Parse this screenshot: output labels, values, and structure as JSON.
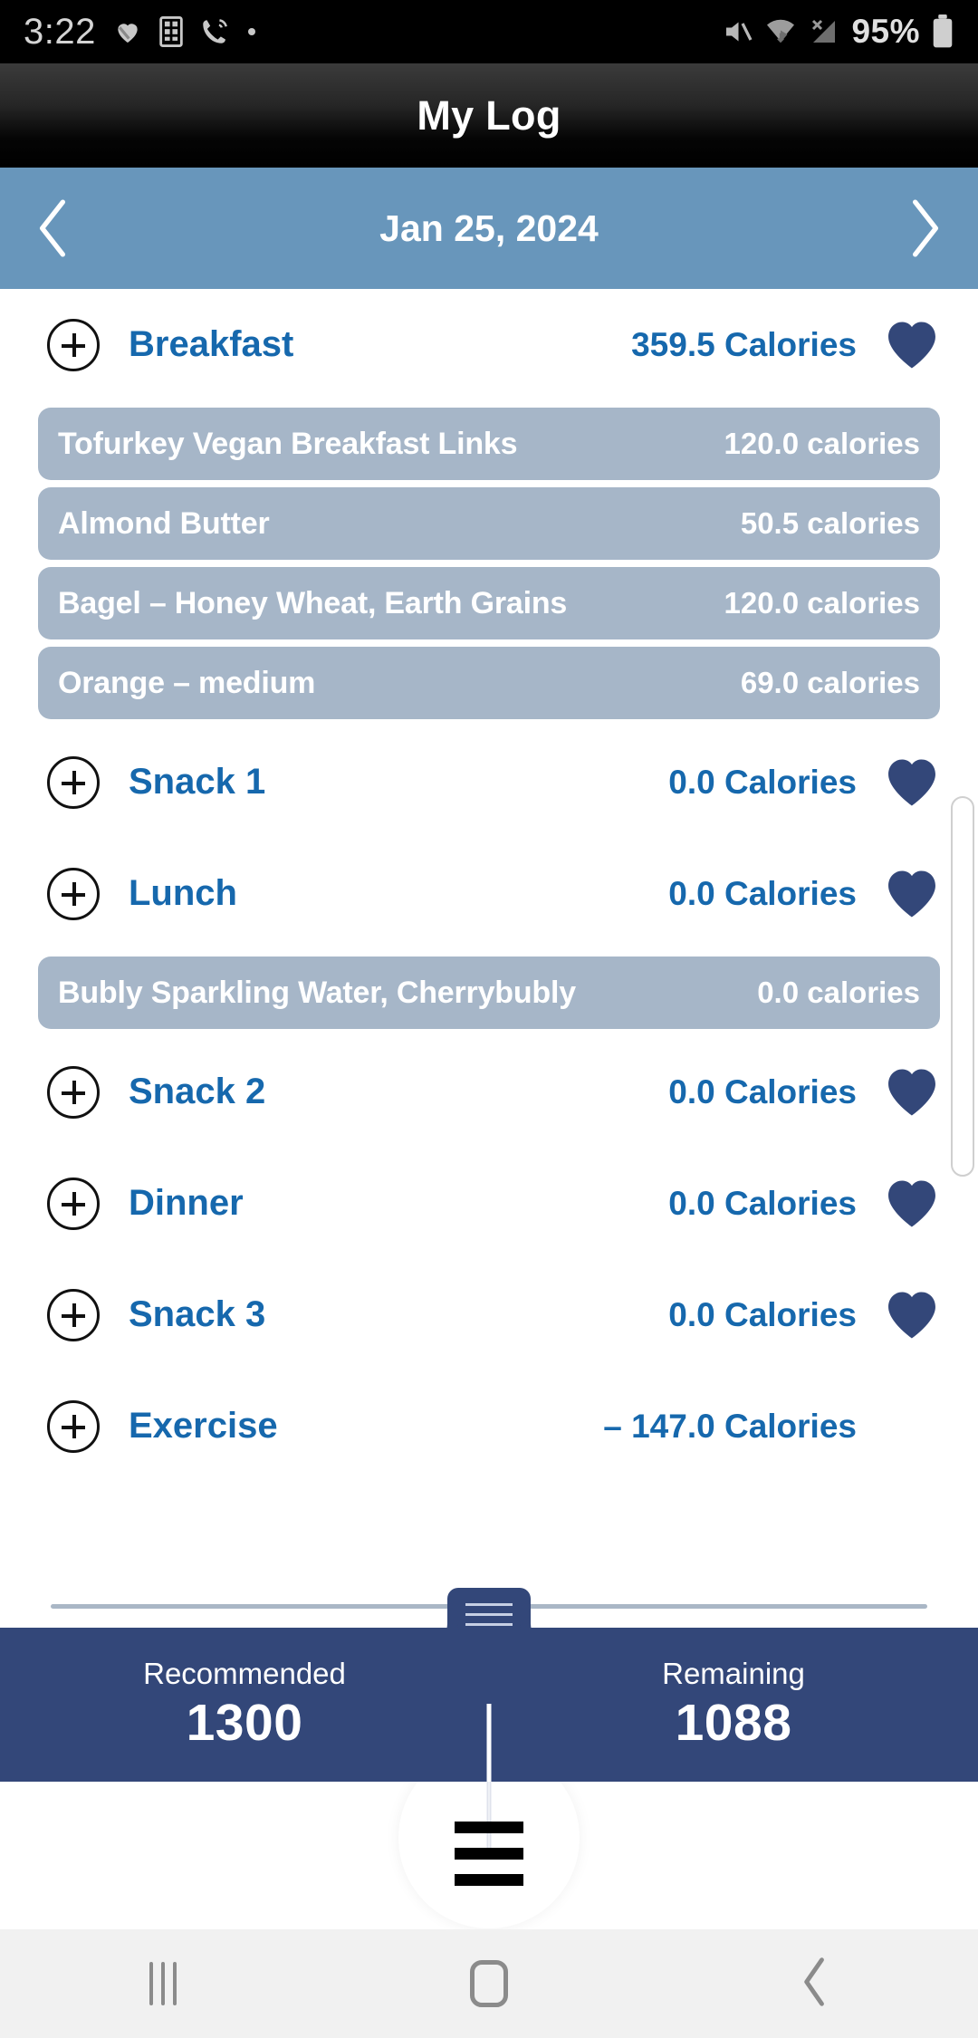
{
  "status_bar": {
    "time": "3:22",
    "battery_percent": "95%",
    "left_icons": [
      "heart-icon",
      "app-grid-icon",
      "wifi-calling-icon",
      "dot-icon"
    ],
    "right_icons": [
      "mute-icon",
      "wifi-icon",
      "signal-off-icon",
      "battery-icon"
    ]
  },
  "header": {
    "title": "My Log"
  },
  "date_bar": {
    "date": "Jan 25, 2024",
    "prev_label": "previous day",
    "next_label": "next day"
  },
  "meals": [
    {
      "name": "Breakfast",
      "calories": "359.5 Calories",
      "has_heart": true,
      "foods": [
        {
          "name": "Tofurkey Vegan Breakfast Links",
          "calories": "120.0 calories"
        },
        {
          "name": "Almond Butter",
          "calories": "50.5 calories"
        },
        {
          "name": "Bagel – Honey Wheat, Earth Grains",
          "calories": "120.0 calories"
        },
        {
          "name": "Orange – medium",
          "calories": "69.0 calories"
        }
      ]
    },
    {
      "name": "Snack 1",
      "calories": "0.0 Calories",
      "has_heart": true,
      "foods": []
    },
    {
      "name": "Lunch",
      "calories": "0.0 Calories",
      "has_heart": true,
      "foods": [
        {
          "name": "Bubly Sparkling Water, Cherrybubly",
          "calories": "0.0 calories"
        }
      ]
    },
    {
      "name": "Snack 2",
      "calories": "0.0 Calories",
      "has_heart": true,
      "foods": []
    },
    {
      "name": "Dinner",
      "calories": "0.0 Calories",
      "has_heart": true,
      "foods": []
    },
    {
      "name": "Snack 3",
      "calories": "0.0 Calories",
      "has_heart": true,
      "foods": []
    },
    {
      "name": "Exercise",
      "calories": "– 147.0 Calories",
      "has_heart": false,
      "foods": []
    }
  ],
  "summary": {
    "recommended_label": "Recommended",
    "recommended_value": "1300",
    "remaining_label": "Remaining",
    "remaining_value": "1088"
  },
  "bottom_menu": {
    "menu_label": "menu"
  },
  "nav_bar": {
    "recents_label": "recents",
    "home_label": "home",
    "back_label": "back"
  },
  "colors": {
    "date_bar": "#6896bb",
    "accent_blue": "#1668ad",
    "navy": "#334779",
    "food_pill": "#a6b6c8",
    "status_bar": "#000000"
  }
}
